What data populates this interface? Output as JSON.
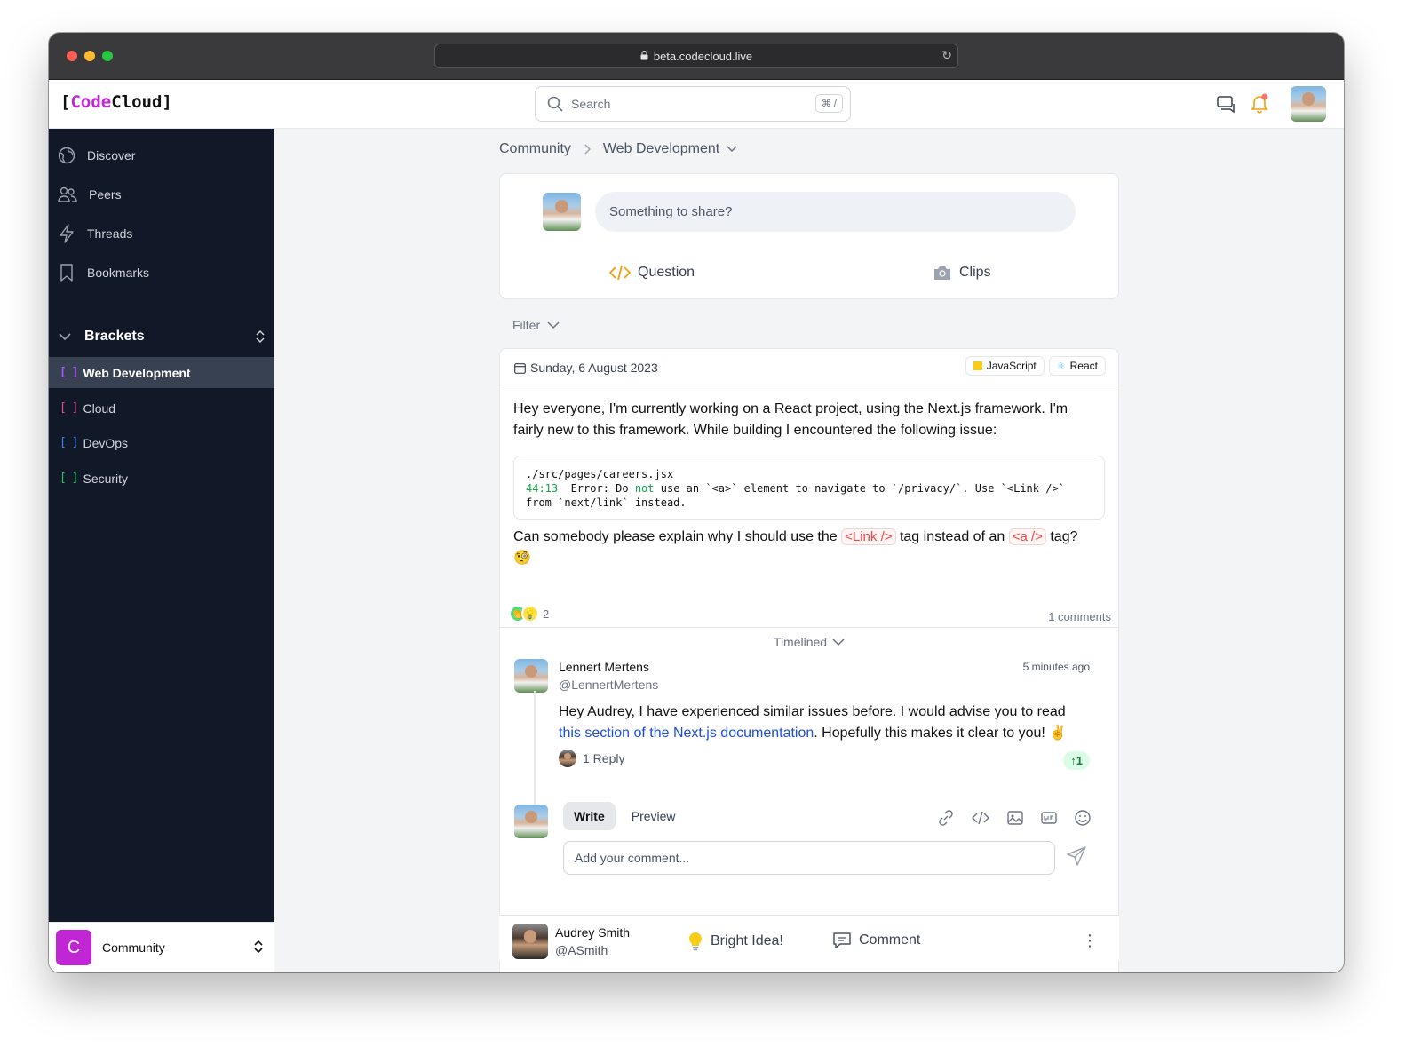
{
  "browser": {
    "url": "beta.codecloud.live"
  },
  "app": {
    "logo_bracket_open": "[",
    "logo_code": "Code",
    "logo_cloud": "Cloud",
    "logo_bracket_close": "]"
  },
  "search": {
    "placeholder": "Search",
    "shortcut": "⌘ /"
  },
  "sidebar": {
    "nav": [
      {
        "label": "Discover",
        "icon": "globe-icon"
      },
      {
        "label": "Peers",
        "icon": "users-icon"
      },
      {
        "label": "Threads",
        "icon": "bolt-icon"
      },
      {
        "label": "Bookmarks",
        "icon": "bookmark-icon"
      }
    ],
    "brackets_title": "Brackets",
    "brackets": [
      {
        "label": "Web Development",
        "color": "#a855f7"
      },
      {
        "label": "Cloud",
        "color": "#ec4899"
      },
      {
        "label": "DevOps",
        "color": "#3b82f6"
      },
      {
        "label": "Security",
        "color": "#22c55e"
      }
    ],
    "footer": {
      "badge": "C",
      "label": "Community"
    }
  },
  "breadcrumb": {
    "root": "Community",
    "current": "Web Development"
  },
  "share": {
    "placeholder": "Something to share?",
    "question": "Question",
    "clips": "Clips"
  },
  "filter": {
    "label": "Filter"
  },
  "post": {
    "date": "Sunday, 6 August 2023",
    "tags": [
      "JavaScript",
      "React"
    ],
    "intro": "Hey everyone, I'm currently working on a React project, using the Next.js framework. I'm fairly new to this framework. While building I encountered the following issue:",
    "code": {
      "line1": "./src/pages/careers.jsx",
      "pos": "44:13",
      "err_a": "  Error: Do ",
      "err_not": "not",
      "err_b": " use an `<a>` element to navigate to `/privacy/`. Use `<Link />`",
      "line3": "from `next/link` instead."
    },
    "question_a": "Can somebody please explain why I should use the ",
    "question_link": "<Link />",
    "question_b": " tag instead of an ",
    "question_a_tag": "<a />",
    "question_c": " tag?",
    "emoji": "🧐",
    "reaction_count": "2",
    "comments": "1 comments",
    "timelined": "Timelined"
  },
  "comment": {
    "name": "Lennert Mertens",
    "handle": "@LennertMertens",
    "time": "5 minutes ago",
    "text_a": "Hey Audrey, I have experienced similar issues before. I would advise you to read ",
    "link": "this section of the Next.js documentation",
    "text_b": ". Hopefully this makes it clear to you! ✌️",
    "replies": "1 Reply",
    "upvotes": "1"
  },
  "composer": {
    "write": "Write",
    "preview": "Preview",
    "placeholder": "Add your comment..."
  },
  "author": {
    "name": "Audrey Smith",
    "handle": "@ASmith",
    "bright": "Bright Idea!",
    "comment": "Comment"
  }
}
